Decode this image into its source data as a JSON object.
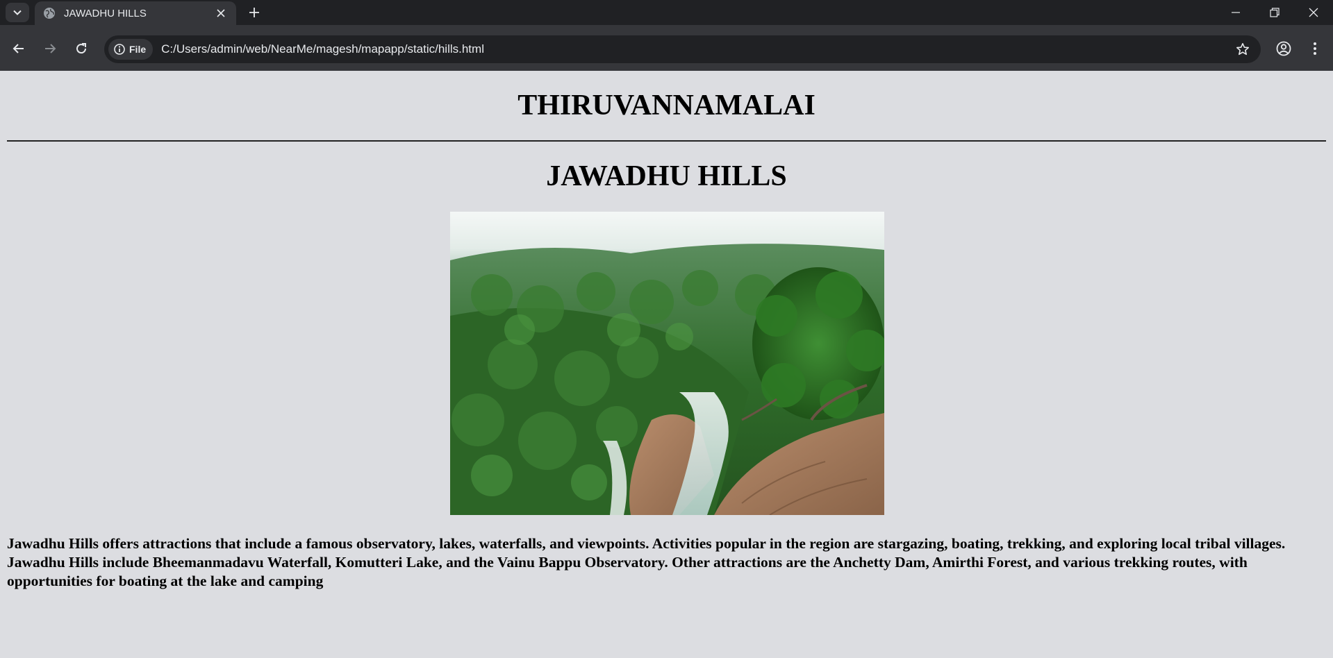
{
  "browser": {
    "tab_title": "JAWADHU HILLS",
    "site_chip": "File",
    "url": "C:/Users/admin/web/NearMe/magesh/mapapp/static/hills.html"
  },
  "page": {
    "city_heading": "THIRUVANNAMALAI",
    "place_heading": "JAWADHU HILLS",
    "description": "Jawadhu Hills offers attractions that include a famous observatory, lakes, waterfalls, and viewpoints. Activities popular in the region are stargazing, boating, trekking, and exploring local tribal villages. Jawadhu Hills include Bheemanmadavu Waterfall, Komutteri Lake, and the Vainu Bappu Observatory. Other attractions are the Anchetty Dam, Amirthi Forest, and various trekking routes, with opportunities for boating at the lake and camping"
  },
  "colors": {
    "page_background": "#dcdde1",
    "tabstrip": "#202124",
    "toolbar": "#35363a",
    "text": "#000000"
  },
  "icons": [
    "tab-search-icon",
    "globe-icon",
    "close-icon",
    "plus-icon",
    "minimize-icon",
    "restore-icon",
    "window-close-icon",
    "back-arrow-icon",
    "forward-arrow-icon",
    "reload-icon",
    "info-icon",
    "star-icon",
    "profile-icon",
    "kebab-menu-icon"
  ]
}
